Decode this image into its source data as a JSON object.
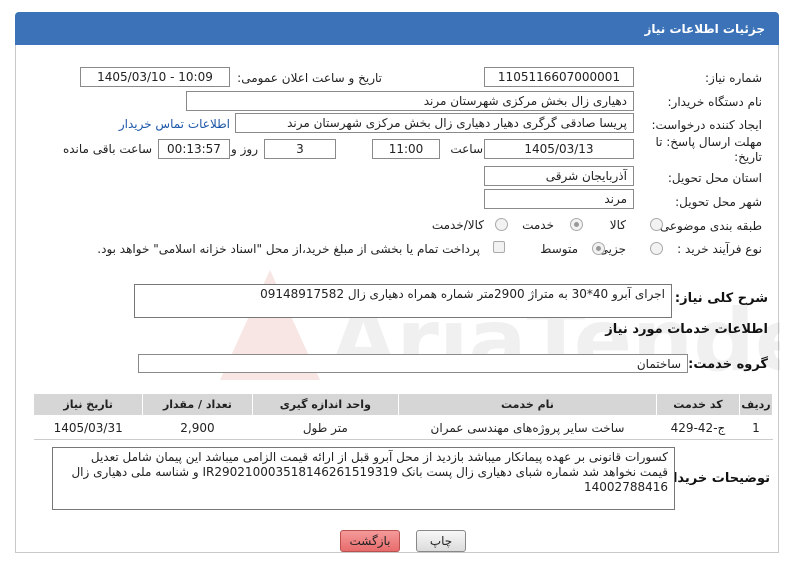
{
  "header": {
    "title": "جزئیات اطلاعات نیاز"
  },
  "form": {
    "need_number": {
      "label": "شماره نیاز:",
      "value": "1105116607000001"
    },
    "announce": {
      "label": "تاریخ و ساعت اعلان عمومی:",
      "value": "1405/03/10 - 10:09"
    },
    "buyer": {
      "label": "نام دستگاه خریدار:",
      "value": "دهیاری زال بخش مرکزی شهرستان مرند"
    },
    "creator": {
      "label": "ایجاد کننده درخواست:",
      "value": "پریسا صادقی گرگری دهیار دهیاری زال بخش مرکزی شهرستان مرند",
      "contact_link": "اطلاعات تماس خریدار"
    },
    "deadline": {
      "label": "مهلت ارسال پاسخ: تا تاریخ:",
      "date": "1405/03/13",
      "time_label": "ساعت",
      "time": "11:00",
      "days": "3",
      "days_label": "روز و",
      "remaining": "00:13:57",
      "remaining_label": "ساعت باقی مانده"
    },
    "province": {
      "label": "استان محل تحویل:",
      "value": "آذربایجان شرقی"
    },
    "city": {
      "label": "شهر محل تحویل:",
      "value": "مرند"
    },
    "category": {
      "label": "طبقه بندی موضوعی:",
      "options": [
        "کالا",
        "خدمت",
        "کالا/خدمت"
      ],
      "selected": "خدمت"
    },
    "process": {
      "label": "نوع فرآیند خرید :",
      "options": [
        "جزیی",
        "متوسط"
      ],
      "selected": "متوسط",
      "note": "پرداخت تمام یا بخشی از مبلغ خرید،از محل \"اسناد خزانه اسلامی\" خواهد بود."
    }
  },
  "summary": {
    "label": "شرح کلی نیاز:",
    "value": "اجرای آبرو 40*30 به متراژ 2900متر شماره همراه دهیاری زال 09148917582"
  },
  "services": {
    "section_title": "اطلاعات خدمات مورد نیاز",
    "group_label": "گروه خدمت:",
    "group_value": "ساختمان",
    "columns": [
      "ردیف",
      "کد خدمت",
      "نام خدمت",
      "واحد اندازه گیری",
      "تعداد / مقدار",
      "تاریخ نیاز"
    ],
    "rows": [
      {
        "idx": "1",
        "code": "ج-42-429",
        "name": "ساخت سایر پروژه‌های مهندسی عمران",
        "unit": "متر طول",
        "qty": "2,900",
        "date": "1405/03/31"
      }
    ]
  },
  "buyer_notes": {
    "label": "توضیحات خریدار:",
    "value": "کسورات قانونی بر عهده پیمانکار میباشد بازدید از محل آبرو قبل از ارائه قیمت الزامی میباشد این پیمان شامل تعدیل قیمت نخواهد شد شماره شبای دهیاری زال پست بانک IR290210003518146261519319 و شناسه ملی دهیاری زال 14002788416"
  },
  "buttons": {
    "print": "چاپ",
    "back": "بازگشت"
  },
  "watermark": "AriaTender.net",
  "colors": {
    "header_bg": "#3c73b8",
    "back_btn": "#f07a7a",
    "link": "#1d57a8"
  }
}
